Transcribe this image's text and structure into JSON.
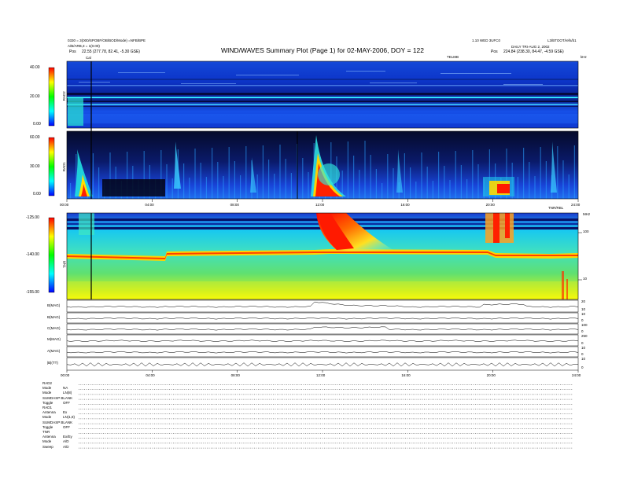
{
  "header": {
    "title": "WIND/WAVES Summary Plot (Page 1) for 02-MAY-2006, DOY = 122",
    "left_line1": "0330 = 3(000/SPOBF/OB/BOD/Mode) =NFB/BPE",
    "left_line2": "A/B/ARB,3 = 1(0.00)",
    "left_pos_label": "Pos",
    "left_pos_value": "22.55 (277.78, 82.41, -5.30 GSE)",
    "right_line1": "1.10 WED 3UFC0",
    "right_line2": "L3/BTOOT/refs/b1",
    "right_line3": "DAILY TRI-AUG 2, 2002",
    "right_pos_label": "Pos",
    "right_pos_value": "224.84 (238.30, 84.47, -4.59 GSE)",
    "right_unit_top": "TELMB",
    "right_tick_top": "kHz"
  },
  "panels": {
    "rad2": {
      "name": "RAD2",
      "ticks": [
        "40.00",
        "20.00",
        "0.00"
      ],
      "cursor_label": "Cal"
    },
    "rad1": {
      "name": "RAD1",
      "ticks": [
        "60.00",
        "30.00",
        "0.00"
      ]
    },
    "tnr": {
      "name": "TNR",
      "ticks": [
        "-125.00",
        "-140.00",
        "-155.00"
      ],
      "right_ticks": [
        "100",
        "10"
      ],
      "right_unit": "MHz"
    },
    "mid_time_ticks": [
      "00:00",
      "04:00",
      "08:00",
      "12:00",
      "16:00",
      "20:00",
      "24:00"
    ],
    "mid_right_label": "TNR/RBL"
  },
  "line_panels": {
    "rows": [
      {
        "label": "B(MAG)",
        "right": [
          "20",
          "10"
        ]
      },
      {
        "label": "B(MAG)",
        "right": [
          "10",
          "0"
        ]
      },
      {
        "label": "C(MAG)",
        "right": [
          "100",
          "0"
        ]
      },
      {
        "label": "M(MAG)",
        "right": [
          "250",
          "0"
        ]
      },
      {
        "label": "A(MAG)",
        "right": [
          "10",
          "0"
        ]
      },
      {
        "label": "|B|(TT)",
        "right": [
          "10",
          "0"
        ]
      }
    ],
    "time_ticks": [
      "00:00",
      "04:00",
      "08:00",
      "12:00",
      "16:00",
      "20:00",
      "24:00"
    ]
  },
  "settings": [
    {
      "k": "RAD2",
      "v": ""
    },
    {
      "k": "Mode",
      "v": "NA"
    },
    {
      "k": "Mode",
      "v": "LN(8)"
    },
    {
      "k": "SUMDASP BLANK",
      "v": ""
    },
    {
      "k": "Toggle",
      "v": "OFF"
    },
    {
      "k": "RAD1",
      "v": ""
    },
    {
      "k": "Antenna",
      "v": "Ex"
    },
    {
      "k": "Mode",
      "v": "LN(1,8)"
    },
    {
      "k": "SUMDASP BLANK",
      "v": ""
    },
    {
      "k": "Toggle",
      "v": "OFF"
    },
    {
      "k": "TNR",
      "v": ""
    },
    {
      "k": "Antenna",
      "v": "Ex/Ey"
    },
    {
      "k": "Mode",
      "v": "A/D"
    },
    {
      "k": "Sweep",
      "v": "A/D"
    }
  ],
  "colors": {
    "spec_bg": "#1a3cd6",
    "spec_dark": "#05082e",
    "colorbar": [
      "#ff0000",
      "#ffff00",
      "#00ff00",
      "#00ffff",
      "#0000ff"
    ]
  },
  "chart_data": {
    "type": "heatmap",
    "title": "WIND/WAVES Summary Plot (Page 1) for 02-MAY-2006, DOY = 122",
    "xlabel": "",
    "ylabel": "",
    "x_ticks": [
      "00:00",
      "04:00",
      "08:00",
      "12:00",
      "16:00",
      "20:00",
      "24:00"
    ],
    "xlim": [
      0,
      24
    ],
    "panels": [
      "RAD2",
      "RAD1",
      "TNR"
    ],
    "events_hours": [
      1.2,
      11.8,
      20.6
    ],
    "grid": false
  }
}
